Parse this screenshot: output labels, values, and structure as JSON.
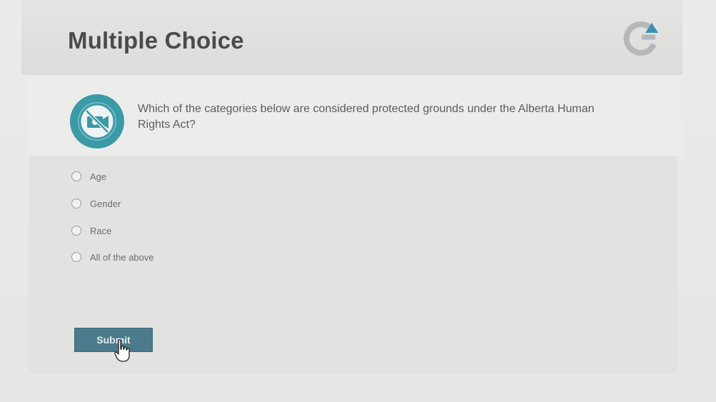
{
  "header": {
    "title": "Multiple Choice"
  },
  "question": {
    "text": "Which of the categories below are considered protected grounds under the Alberta Human Rights Act?"
  },
  "choices": [
    {
      "label": "Age"
    },
    {
      "label": "Gender"
    },
    {
      "label": "Race"
    },
    {
      "label": "All of the above"
    }
  ],
  "actions": {
    "submit_label": "Submit"
  },
  "colors": {
    "accent_teal": "#3a9aa6",
    "button_blue": "#4a7a8c",
    "title_gray": "#4a4b4d"
  },
  "icons": {
    "logo": "refresh-arrow-logo-icon",
    "question": "no-camera-icon",
    "cursor": "hand-pointer-icon"
  }
}
